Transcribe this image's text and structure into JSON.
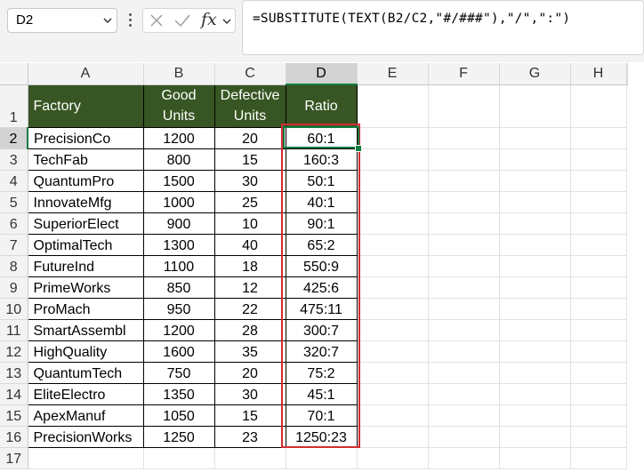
{
  "formula_bar": {
    "name_box": "D2",
    "fx_label": "fx",
    "formula": "=SUBSTITUTE(TEXT(B2/C2,\"#/###\"),\"/\",\":\")"
  },
  "columns": [
    "A",
    "B",
    "C",
    "D",
    "E",
    "F",
    "G",
    "H"
  ],
  "selected_column": "D",
  "selected_row": "2",
  "header_row": {
    "row_number": "1",
    "factory": "Factory",
    "good_units_line1": "Good",
    "good_units_line2": "Units",
    "defective_units_line1": "Defective",
    "defective_units_line2": "Units",
    "ratio": "Ratio"
  },
  "rows": [
    {
      "row": "2",
      "factory": "PrecisionCo",
      "good": "1200",
      "defective": "20",
      "ratio": "60:1"
    },
    {
      "row": "3",
      "factory": "TechFab",
      "good": "800",
      "defective": "15",
      "ratio": "160:3"
    },
    {
      "row": "4",
      "factory": "QuantumPro",
      "good": "1500",
      "defective": "30",
      "ratio": "50:1"
    },
    {
      "row": "5",
      "factory": "InnovateMfg",
      "good": "1000",
      "defective": "25",
      "ratio": "40:1"
    },
    {
      "row": "6",
      "factory": "SuperiorElect",
      "good": "900",
      "defective": "10",
      "ratio": "90:1"
    },
    {
      "row": "7",
      "factory": "OptimalTech",
      "good": "1300",
      "defective": "40",
      "ratio": "65:2"
    },
    {
      "row": "8",
      "factory": "FutureInd",
      "good": "1100",
      "defective": "18",
      "ratio": "550:9"
    },
    {
      "row": "9",
      "factory": "PrimeWorks",
      "good": "850",
      "defective": "12",
      "ratio": "425:6"
    },
    {
      "row": "10",
      "factory": "ProMach",
      "good": "950",
      "defective": "22",
      "ratio": "475:11"
    },
    {
      "row": "11",
      "factory": "SmartAssembl",
      "good": "1200",
      "defective": "28",
      "ratio": "300:7"
    },
    {
      "row": "12",
      "factory": "HighQuality",
      "good": "1600",
      "defective": "35",
      "ratio": "320:7"
    },
    {
      "row": "13",
      "factory": "QuantumTech",
      "good": "750",
      "defective": "20",
      "ratio": "75:2"
    },
    {
      "row": "14",
      "factory": "EliteElectro",
      "good": "1350",
      "defective": "30",
      "ratio": "45:1"
    },
    {
      "row": "15",
      "factory": "ApexManuf",
      "good": "1050",
      "defective": "15",
      "ratio": "70:1"
    },
    {
      "row": "16",
      "factory": "PrecisionWorks",
      "good": "1250",
      "defective": "23",
      "ratio": "1250:23"
    }
  ],
  "empty_rows": [
    "17"
  ],
  "colors": {
    "header_fill": "#375623",
    "highlight_border": "#d22e32",
    "selection": "#107c41"
  }
}
